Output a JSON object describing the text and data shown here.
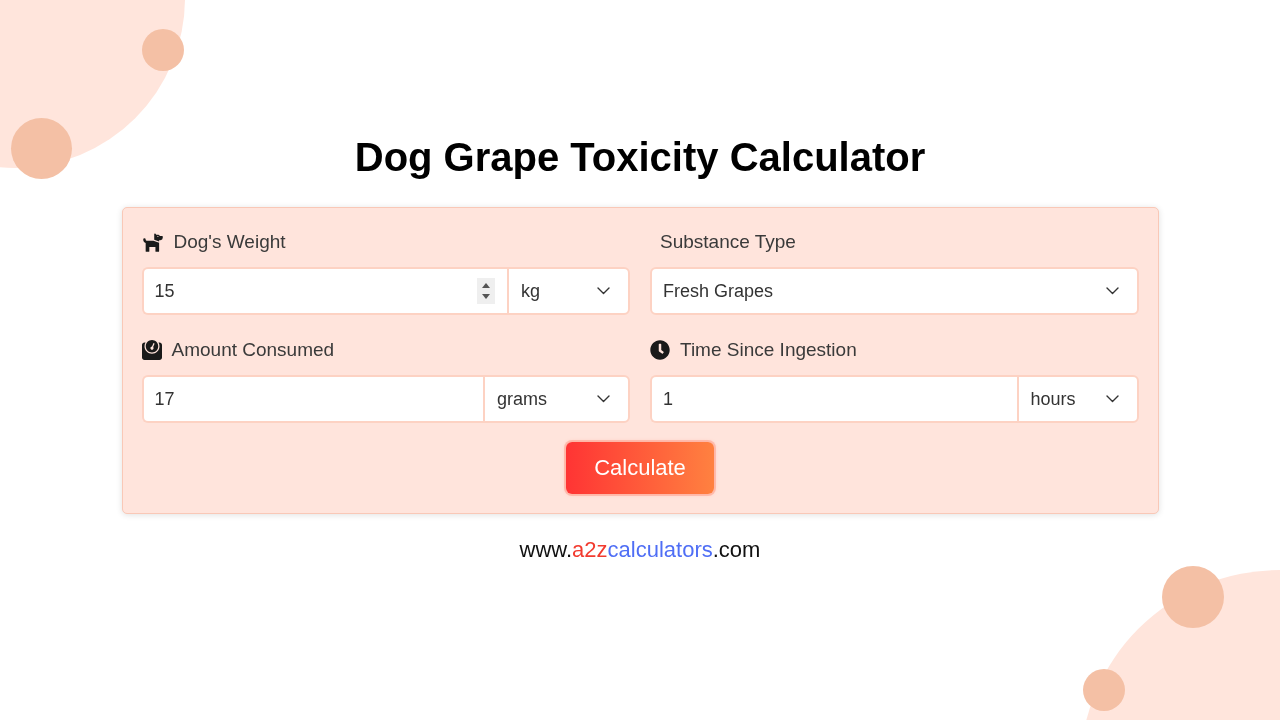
{
  "title": "Dog Grape Toxicity Calculator",
  "form": {
    "fields": [
      {
        "kind": "weight",
        "label": "Dog's Weight",
        "value": "15",
        "unit": "kg"
      },
      {
        "kind": "substance",
        "label": "Substance Type",
        "value": "Fresh Grapes"
      },
      {
        "kind": "amount",
        "label": "Amount Consumed",
        "value": "17",
        "unit": "grams"
      },
      {
        "kind": "time",
        "label": "Time Since Ingestion",
        "value": "1",
        "unit": "hours"
      }
    ],
    "button": "Calculate"
  },
  "footer": {
    "parts": [
      {
        "text": "www.",
        "color": "#111111"
      },
      {
        "text": "a2z",
        "color": "#f23b2f"
      },
      {
        "text": "calculators",
        "color": "#4f6ef5"
      },
      {
        "text": ".com",
        "color": "#111111"
      }
    ]
  }
}
